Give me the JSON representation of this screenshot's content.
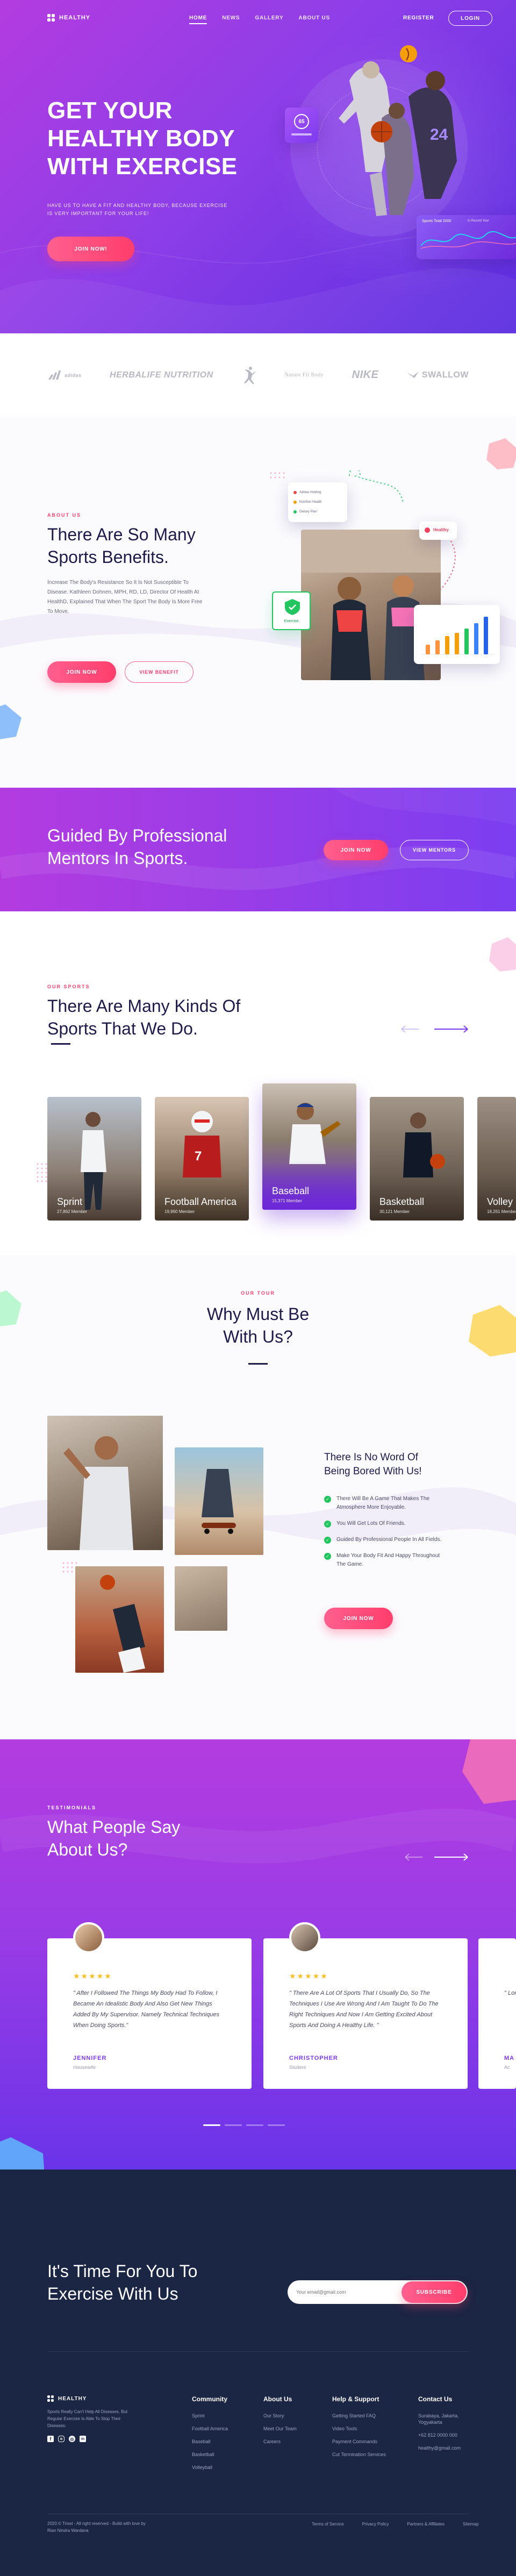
{
  "brand": {
    "name": "HEALTHY"
  },
  "nav": {
    "items": [
      "HOME",
      "NEWS",
      "GALLERY",
      "ABOUT US"
    ],
    "register": "REGISTER",
    "login": "LOGIN"
  },
  "hero": {
    "title_line1": "GET YOUR",
    "title_line2": "HEALTHY BODY",
    "title_line3": "WITH EXERCISE",
    "subtitle": "HAVE US TO HAVE A FIT AND HEALTHY BODY, BECAUSE EXERCISE IS VERY IMPORTANT FOR YOUR LIFE!",
    "cta": "JOIN NOW!",
    "stat_card_value": "65",
    "chart_card_title": "Sports Total 2000",
    "chart_card_badge": "In Record Year"
  },
  "partners": [
    "adidas",
    "HERBALIFE NUTRITION",
    "JUMPMAN",
    "Nature Fit Body",
    "NIKE",
    "SWALLOW"
  ],
  "benefits": {
    "label": "ABOUT US",
    "title_line1": "There Are So Many",
    "title_line2": "Sports Benefits.",
    "text": "Increase The Body's Resistance So It Is Not Susceptible To Disease. Kathleen Dohnen, MPH, RD, LD, Director Of Health At HealthD, Explained That When The Sport The Body Is More Free To Move.",
    "btn_join": "JOIN NOW",
    "btn_benefit": "VIEW BENEFIT",
    "list_items": [
      "Adidas Holding",
      "Nutrition Health",
      "Dietary Plan"
    ],
    "badge_tag": "Healthy",
    "green_card_label": "Exercise"
  },
  "mentors": {
    "title_line1": "Guided By Professional",
    "title_line2": "Mentors In Sports.",
    "btn_join": "JOIN NOW",
    "btn_view": "VIEW MENTORS"
  },
  "sports": {
    "label": "OUR SPORTS",
    "title_line1": "There Are Many Kinds Of",
    "title_line2": "Sports That We Do.",
    "cards": [
      {
        "name": "Sprint",
        "members": "27,862 Member"
      },
      {
        "name": "Football America",
        "members": "19,960 Member"
      },
      {
        "name": "Baseball",
        "members": "15,371 Member"
      },
      {
        "name": "Basketball",
        "members": "30,121 Member"
      },
      {
        "name": "Volley",
        "members": "18,261 Member"
      }
    ]
  },
  "why": {
    "label": "OUR TOUR",
    "title_line1": "Why Must Be",
    "title_line2": "With Us?",
    "subtitle_line1": "There Is No Word Of",
    "subtitle_line2": "Being Bored With Us!",
    "items": [
      "There Will Be A Game That Makes The Atmosphere More Enjoyable.",
      "You Will Get Lots Of Friends.",
      "Guided By Professional People In All Fields.",
      "Make Your Body Fit And Happy Throughout The Game."
    ],
    "cta": "JOIN NOW"
  },
  "testimonials": {
    "label": "TESTIMONIALS",
    "title_line1": "What People Say",
    "title_line2": "About Us?",
    "cards": [
      {
        "quote": "\" After I Followed The Things My Body Had To Follow, I Became An Idealistic Body And Also Get New Things Added By My Supervisor. Namely Technical Techniques When Doing Sports.\"",
        "name": "JENNIFER",
        "role": "Housewife"
      },
      {
        "quote": "\" There Are A Lot Of Sports That I Usually Do, So The Techniques I Use Are Wrong And I Am Taught To Do The Right Techniques And Now I Am Getting Excited About Sports And Doing A Healthy Life. \"",
        "name": "CHRISTOPHER",
        "role": "Student"
      },
      {
        "quote": "\" Long Life ...",
        "name": "MA",
        "role": "Ac"
      }
    ]
  },
  "cta_section": {
    "title_line1": "It's Time For You To",
    "title_line2": "Exercise With Us",
    "email_placeholder": "Your email@gmail.com",
    "subscribe": "SUBSCRIBE"
  },
  "footer": {
    "brand_text": "Sports Really Can't Help All Diseases, But Regular Exercise Is Able To Stop Their Diseases.",
    "columns": [
      {
        "title": "Community",
        "links": [
          "Sprint",
          "Football America",
          "Baseball",
          "Basketball",
          "Volleyball"
        ]
      },
      {
        "title": "About Us",
        "links": [
          "Our Story",
          "Meet Our Team",
          "Careers"
        ]
      },
      {
        "title": "Help & Support",
        "links": [
          "Getting Started FAQ",
          "Video Tools",
          "Payment Commands",
          "Cut Termination Services"
        ]
      },
      {
        "title": "Contact Us",
        "links": [
          "Surabaya, Jakarta, Yogyakarta",
          "+62 812 0000 000",
          "healthy@gmail.com"
        ]
      }
    ],
    "copyright": "2020 © Trixel - All right reserved - Build with love by Rian Nindra Wardana",
    "bottom_links": [
      "Terms of Service",
      "Privacy Policy",
      "Partners & Affiliates",
      "Sitemap"
    ]
  },
  "colors": {
    "purple": "#8d3ee8",
    "pink": "#ff3e6c",
    "navy": "#1b2544",
    "green": "#22c55e"
  }
}
